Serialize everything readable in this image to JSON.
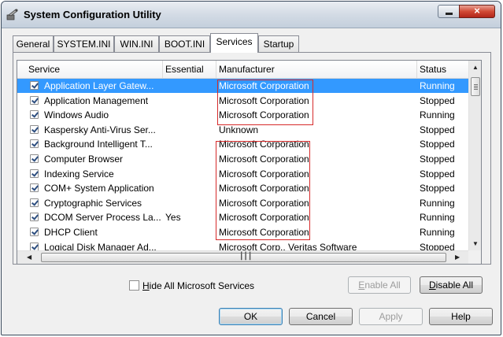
{
  "window": {
    "title": "System Configuration Utility",
    "close_glyph": "×"
  },
  "tabs": [
    {
      "label": "General"
    },
    {
      "label": "SYSTEM.INI"
    },
    {
      "label": "WIN.INI"
    },
    {
      "label": "BOOT.INI"
    },
    {
      "label": "Services"
    },
    {
      "label": "Startup"
    }
  ],
  "active_tab": "Services",
  "columns": {
    "service": "Service",
    "essential": "Essential",
    "manufacturer": "Manufacturer",
    "status": "Status"
  },
  "rows": [
    {
      "checked": true,
      "service": "Application Layer Gatew...",
      "essential": "",
      "manufacturer": "Microsoft Corporation",
      "status": "Running"
    },
    {
      "checked": true,
      "service": "Application Management",
      "essential": "",
      "manufacturer": "Microsoft Corporation",
      "status": "Stopped"
    },
    {
      "checked": true,
      "service": "Windows Audio",
      "essential": "",
      "manufacturer": "Microsoft Corporation",
      "status": "Running"
    },
    {
      "checked": true,
      "service": "Kaspersky Anti-Virus Ser...",
      "essential": "",
      "manufacturer": "Unknown",
      "status": "Stopped"
    },
    {
      "checked": true,
      "service": "Background Intelligent T...",
      "essential": "",
      "manufacturer": "Microsoft Corporation",
      "status": "Stopped"
    },
    {
      "checked": true,
      "service": "Computer Browser",
      "essential": "",
      "manufacturer": "Microsoft Corporation",
      "status": "Stopped"
    },
    {
      "checked": true,
      "service": "Indexing Service",
      "essential": "",
      "manufacturer": "Microsoft Corporation",
      "status": "Stopped"
    },
    {
      "checked": true,
      "service": "COM+ System Application",
      "essential": "",
      "manufacturer": "Microsoft Corporation",
      "status": "Stopped"
    },
    {
      "checked": true,
      "service": "Cryptographic Services",
      "essential": "",
      "manufacturer": "Microsoft Corporation",
      "status": "Running"
    },
    {
      "checked": true,
      "service": "DCOM Server Process La...",
      "essential": "Yes",
      "manufacturer": "Microsoft Corporation",
      "status": "Running"
    },
    {
      "checked": true,
      "service": "DHCP Client",
      "essential": "",
      "manufacturer": "Microsoft Corporation",
      "status": "Running"
    },
    {
      "checked": true,
      "service": "Logical Disk Manager Ad...",
      "essential": "",
      "manufacturer": "Microsoft Corp., Veritas Software",
      "status": "Stopped"
    }
  ],
  "hide_ms": {
    "label": "Hide All Microsoft Services",
    "checked": false
  },
  "buttons": {
    "enable_all": "Enable All",
    "disable_all": "Disable All",
    "ok": "OK",
    "cancel": "Cancel",
    "apply": "Apply",
    "help": "Help"
  },
  "colors": {
    "selection": "#3399ff",
    "highlight_box": "#d62a2a",
    "title_gradient_top": "#e9edf2",
    "close_button": "#d14a36"
  },
  "icons": {
    "app": "system-config-icon",
    "minimize": "minimize-icon",
    "close": "close-icon"
  }
}
